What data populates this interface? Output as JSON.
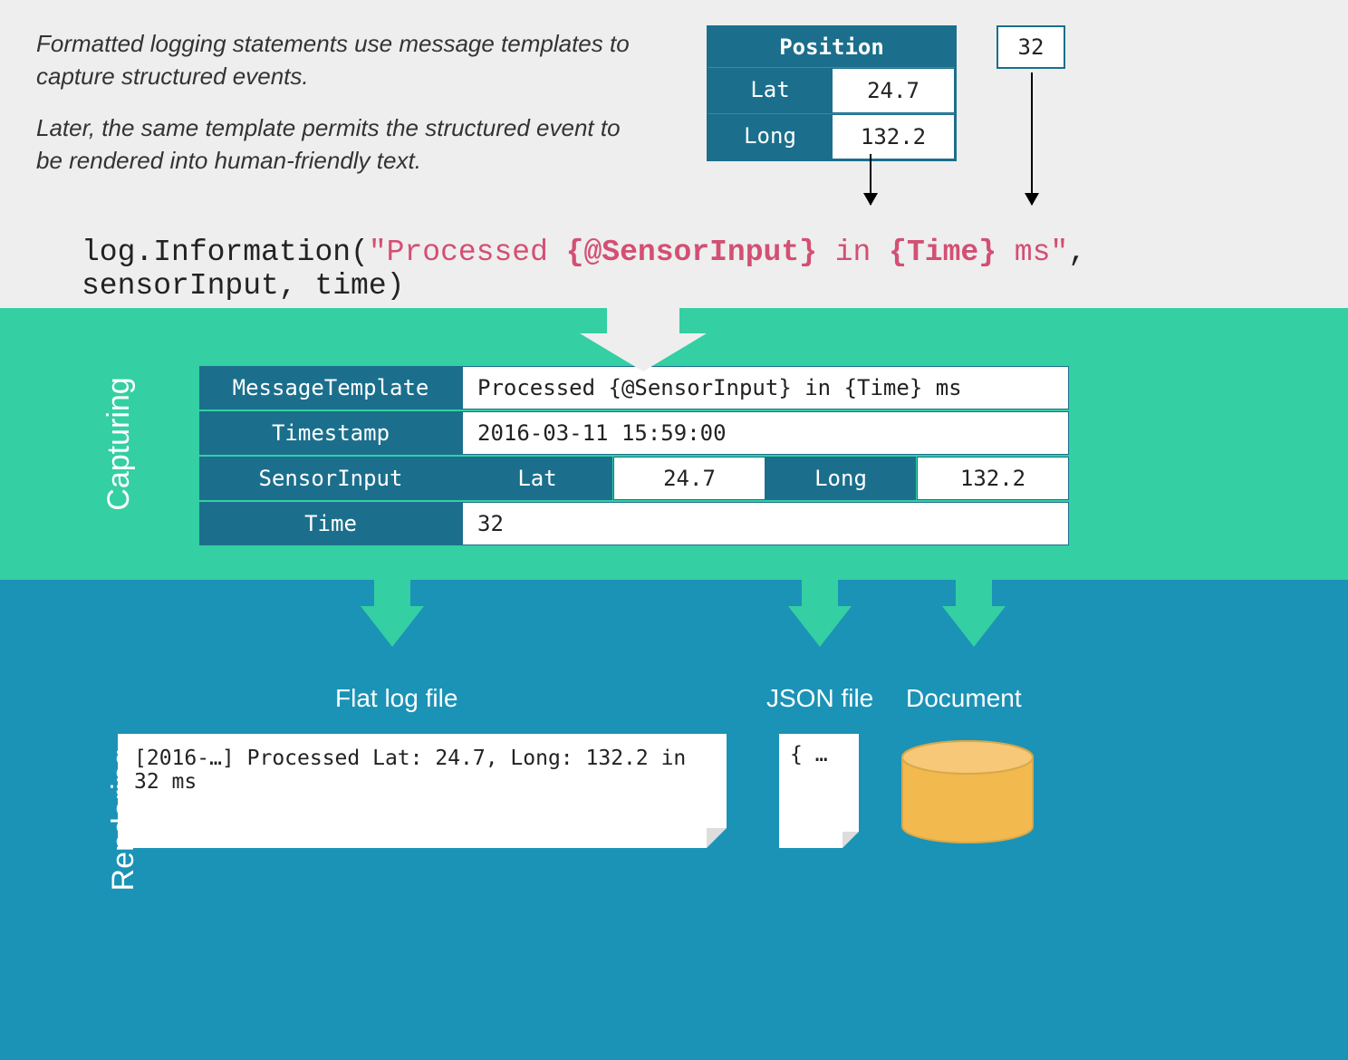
{
  "intro": {
    "paragraph1": "Formatted logging statements use message templates to capture structured events.",
    "paragraph2": "Later, the same template permits the structured event to be rendered into human-friendly text."
  },
  "position_box": {
    "title": "Position",
    "lat_label": "Lat",
    "lat_value": "24.7",
    "long_label": "Long",
    "long_value": "132.2"
  },
  "time_box": {
    "value": "32"
  },
  "log_statement": {
    "prefix": "log.Information(",
    "quote_open": "\"Processed ",
    "token1": "{@SensorInput}",
    "mid": " in ",
    "token2": "{Time}",
    "quote_close": " ms\"",
    "suffix": ", sensorInput, time)"
  },
  "sections": {
    "capturing": "Capturing",
    "rendering": "Rendering"
  },
  "capture": {
    "rows": {
      "template_label": "MessageTemplate",
      "template_value": "Processed {@SensorInput} in {Time} ms",
      "timestamp_label": "Timestamp",
      "timestamp_value": "2016-03-11 15:59:00",
      "sensor_label": "SensorInput",
      "sensor_lat_label": "Lat",
      "sensor_lat_value": "24.7",
      "sensor_long_label": "Long",
      "sensor_long_value": "132.2",
      "time_label": "Time",
      "time_value": "32"
    }
  },
  "outputs": {
    "flat_label": "Flat log file",
    "json_label": "JSON file",
    "doc_label": "Document",
    "flat_content": "[2016-…] Processed Lat: 24.7, Long: 132.2 in 32 ms",
    "json_content": "{ …"
  }
}
